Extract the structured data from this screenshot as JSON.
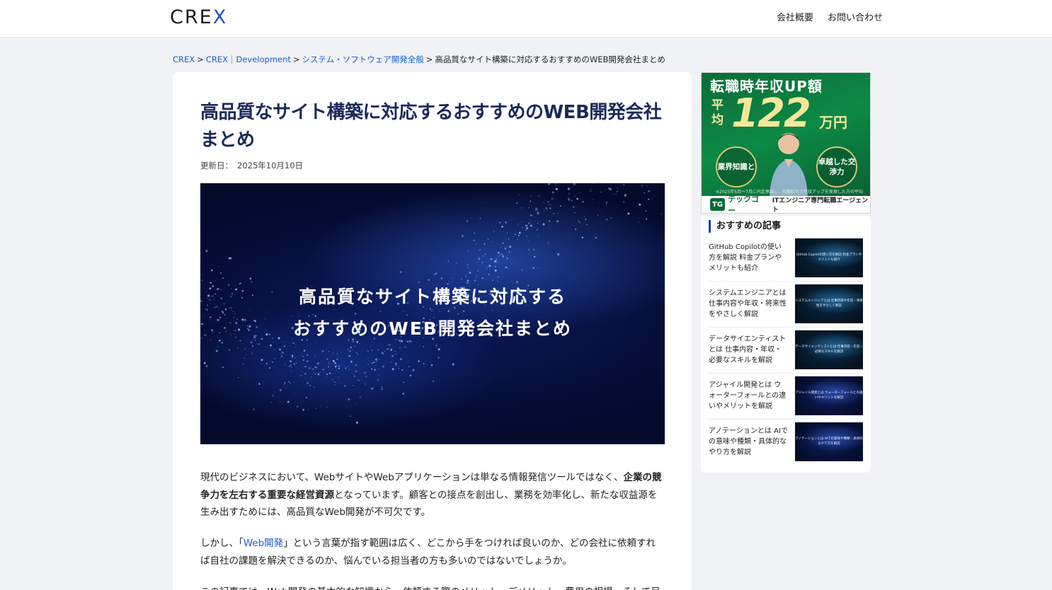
{
  "header": {
    "logo_prefix": "CRE",
    "logo_x": "X",
    "nav": [
      {
        "label": "会社概要"
      },
      {
        "label": "お問い合わせ"
      }
    ]
  },
  "breadcrumb": [
    {
      "label": "CREX",
      "link": true
    },
    {
      "label": "CREX｜Development",
      "link": true
    },
    {
      "label": "システム・ソフトウェア開発全般",
      "link": true
    },
    {
      "label": "高品質なサイト構築に対応するおすすめのWEB開発会社まとめ",
      "link": false
    }
  ],
  "article": {
    "title": "高品質なサイト構築に対応するおすすめのWEB開発会社まとめ",
    "updated_label": "更新日：",
    "updated_date": "2025年10月10日",
    "hero_line1": "高品質なサイト構築に対応する",
    "hero_line2": "おすすめのWEB開発会社まとめ",
    "p1_a": "現代のビジネスにおいて、WebサイトやWebアプリケーションは単なる情報発信ツールではなく、",
    "p1_strong": "企業の競争力を左右する重要な経営資源",
    "p1_b": "となっています。顧客との接点を創出し、業務を効率化し、新たな収益源を生み出すためには、高品質なWeb開発が不可欠です。",
    "p2_a": "しかし、「",
    "p2_link": "Web開発",
    "p2_b": "」という言葉が指す範囲は広く、どこから手をつければ良いのか、どの会社に依頼すれば自社の課題を解決できるのか、悩んでいる担当者の方も多いのではないでしょうか。",
    "p3": "この記事では、Web開発の基本的な知識から、依頼する際のメリット・デメリット、費用の相場、そして目"
  },
  "ad": {
    "line1": "転職時年収UP額",
    "avg": "平均",
    "amount": "122",
    "unit": "万円",
    "badge_left": "業界知識と",
    "badge_right": "卓越した交渉力",
    "note": "※2025年5月～7月に内定承諾し、前職給与で年収アップを実現した方の平均",
    "logo_mark": "TG",
    "logo": "テックゴー",
    "tagline": "ITエンジニア専門転職エージェント"
  },
  "recommended": {
    "heading": "おすすめの記事",
    "items": [
      {
        "title": "GitHub Copilotの使い方を解説 料金プランやメリットも紹介",
        "thumb": "GitHub Copilotの使い方を解説 料金プランやメリットも紹介"
      },
      {
        "title": "システムエンジニアとは 仕事内容や年収・将来性をやさしく解説",
        "thumb": "システムエンジニアとは 仕事内容や年収・将来性をやさしく解説"
      },
      {
        "title": "データサイエンティストとは 仕事内容・年収・必要なスキルを解説",
        "thumb": "データサイエンティストとは 仕事内容・年収・必要なスキルを解説"
      },
      {
        "title": "アジャイル開発とは ウォーターフォールとの違いやメリットを解説",
        "thumb": "アジャイル開発とは ウォーターフォールとの違いやメリットを解説"
      },
      {
        "title": "アノテーションとは AIでの意味や種類・具体的なやり方を解説",
        "thumb": "アノテーションとは AIでの意味や種類・具体的なやり方を解説"
      }
    ]
  }
}
